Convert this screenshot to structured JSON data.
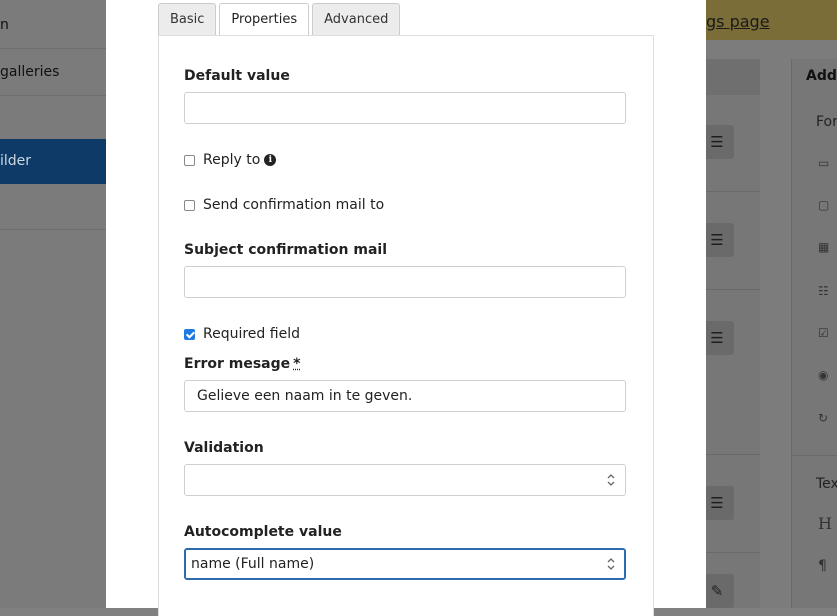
{
  "background": {
    "nav_items": [
      {
        "label": "n",
        "active": false
      },
      {
        "label": "galleries",
        "active": false
      },
      {
        "label": "",
        "active": false
      },
      {
        "label": "ilder",
        "active": true
      },
      {
        "label": "",
        "active": false
      }
    ],
    "banner_link": "gs page",
    "panel_title": "Add",
    "panel_sub_1": "For",
    "panel_sub_2": "Tex",
    "panel_icon_h": "H",
    "panel_icon_p": "¶",
    "handle_icon": "☰"
  },
  "modal": {
    "tabs": [
      {
        "label": "Basic",
        "active": false
      },
      {
        "label": "Properties",
        "active": true
      },
      {
        "label": "Advanced",
        "active": false
      }
    ],
    "default_value": {
      "label": "Default value",
      "value": ""
    },
    "reply_to": {
      "label": "Reply to",
      "checked": false
    },
    "send_confirmation": {
      "label": "Send confirmation mail to",
      "checked": false
    },
    "subject_confirmation": {
      "label": "Subject confirmation mail",
      "value": ""
    },
    "required_field": {
      "label": "Required field",
      "checked": true
    },
    "error_message": {
      "label": "Error mesage",
      "required_mark": "*",
      "value": "Gelieve een naam in te geven."
    },
    "validation": {
      "label": "Validation",
      "selected": ""
    },
    "autocomplete": {
      "label": "Autocomplete value",
      "selected": "name (Full name)"
    }
  }
}
